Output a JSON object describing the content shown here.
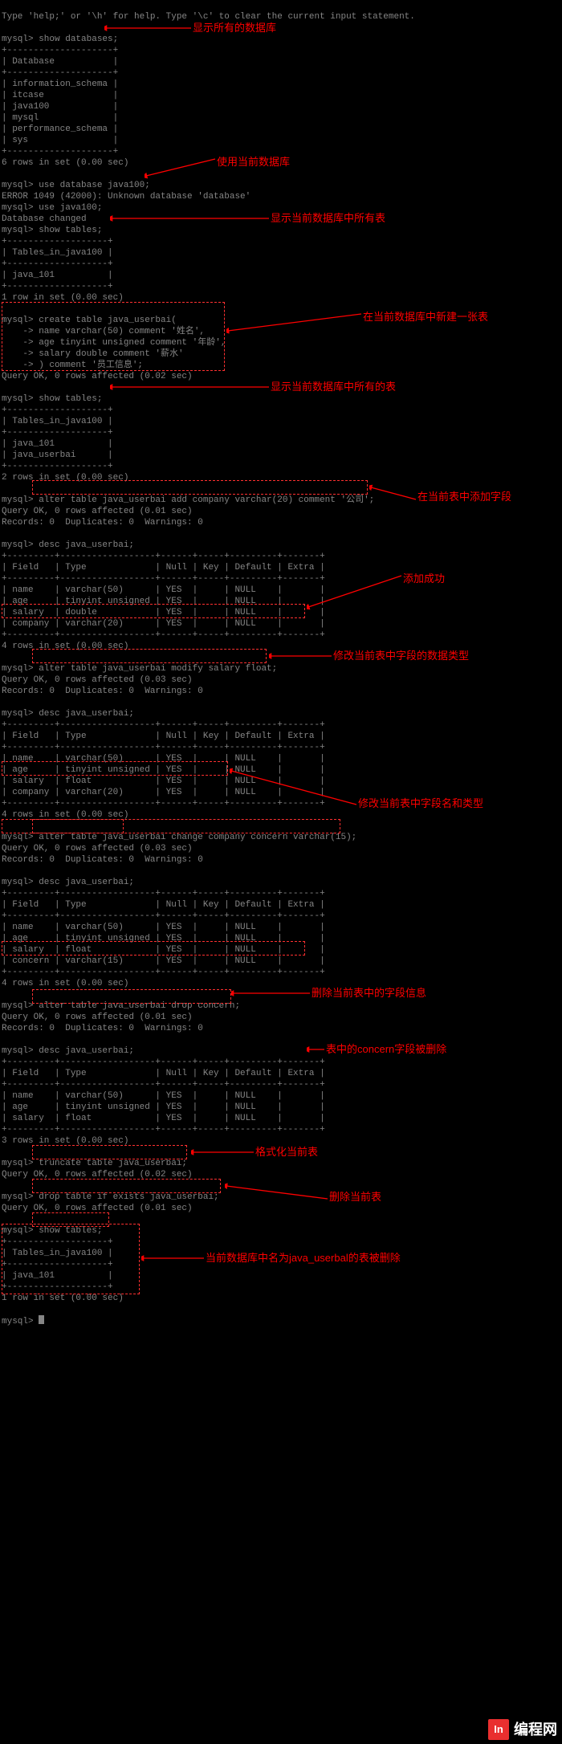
{
  "terminal": {
    "l0": "Type 'help;' or '\\h' for help. Type '\\c' to clear the current input statement.",
    "l1": "",
    "l2": "mysql> show databases;",
    "l3": "+--------------------+",
    "l4": "| Database           |",
    "l5": "+--------------------+",
    "l6": "| information_schema |",
    "l7": "| itcase             |",
    "l8": "| java100            |",
    "l9": "| mysql              |",
    "l10": "| performance_schema |",
    "l11": "| sys                |",
    "l12": "+--------------------+",
    "l13": "6 rows in set (0.00 sec)",
    "l14": "",
    "l15": "mysql> use database java100;",
    "l16": "ERROR 1049 (42000): Unknown database 'database'",
    "l17": "mysql> use java100;",
    "l18": "Database changed",
    "l19": "mysql> show tables;",
    "l20": "+-------------------+",
    "l21": "| Tables_in_java100 |",
    "l22": "+-------------------+",
    "l23": "| java_101          |",
    "l24": "+-------------------+",
    "l25": "1 row in set (0.00 sec)",
    "l26": "",
    "l27": "mysql> create table java_userbai(",
    "l28": "    -> name varchar(50) comment '姓名',",
    "l29": "    -> age tinyint unsigned comment '年龄',",
    "l30": "    -> salary double comment '薪水'",
    "l31": "    -> ) comment '员工信息';",
    "l32": "Query OK, 0 rows affected (0.02 sec)",
    "l33": "",
    "l34": "mysql> show tables;",
    "l35": "+-------------------+",
    "l36": "| Tables_in_java100 |",
    "l37": "+-------------------+",
    "l38": "| java_101          |",
    "l39": "| java_userbai      |",
    "l40": "+-------------------+",
    "l41": "2 rows in set (0.00 sec)",
    "l42": "",
    "l43": "mysql> alter table java_userbai add company varchar(20) comment '公司';",
    "l44": "Query OK, 0 rows affected (0.01 sec)",
    "l45": "Records: 0  Duplicates: 0  Warnings: 0",
    "l46": "",
    "l47": "mysql> desc java_userbai;",
    "l48": "+---------+------------------+------+-----+---------+-------+",
    "l49": "| Field   | Type             | Null | Key | Default | Extra |",
    "l50": "+---------+------------------+------+-----+---------+-------+",
    "l51": "| name    | varchar(50)      | YES  |     | NULL    |       |",
    "l52": "| age     | tinyint unsigned | YES  |     | NULL    |       |",
    "l53": "| salary  | double           | YES  |     | NULL    |       |",
    "l54": "| company | varchar(20)      | YES  |     | NULL    |       |",
    "l55": "+---------+------------------+------+-----+---------+-------+",
    "l56": "4 rows in set (0.00 sec)",
    "l57": "",
    "l58": "mysql> alter table java_userbai modify salary float;",
    "l59": "Query OK, 0 rows affected (0.03 sec)",
    "l60": "Records: 0  Duplicates: 0  Warnings: 0",
    "l61": "",
    "l62": "mysql> desc java_userbai;",
    "l63": "+---------+------------------+------+-----+---------+-------+",
    "l64": "| Field   | Type             | Null | Key | Default | Extra |",
    "l65": "+---------+------------------+------+-----+---------+-------+",
    "l66": "| name    | varchar(50)      | YES  |     | NULL    |       |",
    "l67": "| age     | tinyint unsigned | YES  |     | NULL    |       |",
    "l68": "| salary  | float            | YES  |     | NULL    |       |",
    "l69": "| company | varchar(20)      | YES  |     | NULL    |       |",
    "l70": "+---------+------------------+------+-----+---------+-------+",
    "l71": "4 rows in set (0.00 sec)",
    "l72": "",
    "l73": "mysql> alter table java_userbai change company concern varchar(15);",
    "l74": "Query OK, 0 rows affected (0.03 sec)",
    "l75": "Records: 0  Duplicates: 0  Warnings: 0",
    "l76": "",
    "l77": "mysql> desc java_userbai;",
    "l78": "+---------+------------------+------+-----+---------+-------+",
    "l79": "| Field   | Type             | Null | Key | Default | Extra |",
    "l80": "+---------+------------------+------+-----+---------+-------+",
    "l81": "| name    | varchar(50)      | YES  |     | NULL    |       |",
    "l82": "| age     | tinyint unsigned | YES  |     | NULL    |       |",
    "l83": "| salary  | float            | YES  |     | NULL    |       |",
    "l84": "| concern | varchar(15)      | YES  |     | NULL    |       |",
    "l85": "+---------+------------------+------+-----+---------+-------+",
    "l86": "4 rows in set (0.00 sec)",
    "l87": "",
    "l88": "mysql> alter table java_userbai drop concern;",
    "l89": "Query OK, 0 rows affected (0.01 sec)",
    "l90": "Records: 0  Duplicates: 0  Warnings: 0",
    "l91": "",
    "l92": "mysql> desc java_userbai;",
    "l93": "+---------+------------------+------+-----+---------+-------+",
    "l94": "| Field   | Type             | Null | Key | Default | Extra |",
    "l95": "+---------+------------------+------+-----+---------+-------+",
    "l96": "| name    | varchar(50)      | YES  |     | NULL    |       |",
    "l97": "| age     | tinyint unsigned | YES  |     | NULL    |       |",
    "l98": "| salary  | float            | YES  |     | NULL    |       |",
    "l99": "+---------+------------------+------+-----+---------+-------+",
    "l100": "3 rows in set (0.00 sec)",
    "l101": "",
    "l102": "mysql> truncate table java_userbai;",
    "l103": "Query OK, 0 rows affected (0.02 sec)",
    "l104": "",
    "l105": "mysql> drop table if exists java_userbai;",
    "l106": "Query OK, 0 rows affected (0.01 sec)",
    "l107": "",
    "l108": "mysql> show tables;",
    "l109": "+-------------------+",
    "l110": "| Tables_in_java100 |",
    "l111": "+-------------------+",
    "l112": "| java_101          |",
    "l113": "+-------------------+",
    "l114": "1 row in set (0.00 sec)",
    "l115": "",
    "l116": "mysql> "
  },
  "annot": {
    "a1": "显示所有的数据库",
    "a2": "使用当前数据库",
    "a3": "显示当前数据库中所有表",
    "a4": "在当前数据库中新建一张表",
    "a5": "显示当前数据库中所有的表",
    "a6": "在当前表中添加字段",
    "a7": "添加成功",
    "a8": "修改当前表中字段的数据类型",
    "a9": "修改当前表中字段名和类型",
    "a10": "删除当前表中的字段信息",
    "a11": "表中的concern字段被删除",
    "a12": "格式化当前表",
    "a13": "删除当前表",
    "a14": "当前数据库中名为java_userbal的表被删除"
  },
  "watermark": {
    "badge": "In",
    "text": "编程网"
  }
}
